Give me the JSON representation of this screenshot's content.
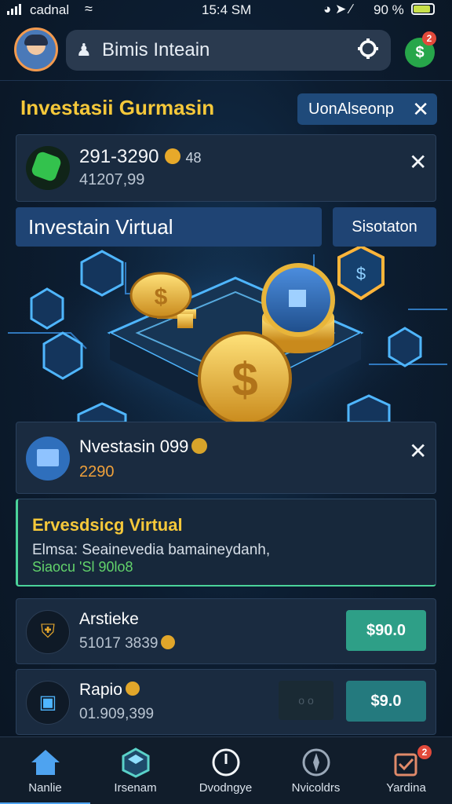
{
  "status_bar": {
    "carrier": "cadnal",
    "time": "15:4 SM",
    "battery": "90 %",
    "battery_level": 0.8
  },
  "header": {
    "search_text": "Bimis Inteain",
    "notification_count": "2"
  },
  "page": {
    "title": "Investasii Gurmasin",
    "pill_label": "UonAlseonp"
  },
  "balance_card": {
    "main_value": "291-3290",
    "tag": "48",
    "sub_value": "41207,99"
  },
  "section": {
    "title": "Investain Virtual",
    "button": "Sisotaton"
  },
  "investment_card": {
    "title": "Nvestasin 099",
    "amount": "2290"
  },
  "notice": {
    "heading": "Ervesdsiсg Virtual",
    "description": "Elmsa: Seainevedia bamaineydanh,",
    "status": "Siaocu 'Sl 90lo8"
  },
  "list": [
    {
      "name": "Arstieke",
      "sub": "51017 3839",
      "price": "$90.0"
    },
    {
      "name": "Rapio",
      "sub": "01.909,399",
      "price": "$9.0",
      "ghost": "o o"
    }
  ],
  "bottom_nav": {
    "items": [
      {
        "label": "Nanlie"
      },
      {
        "label": "Irsenam"
      },
      {
        "label": "Dvodngye"
      },
      {
        "label": "Nvicoldrs"
      },
      {
        "label": "Yardina"
      }
    ],
    "badge": "2"
  },
  "colors": {
    "accent_gold": "#f5c83a",
    "primary_blue": "#1f4474",
    "success_green": "#2e9f87",
    "alert_red": "#e24a3b"
  }
}
